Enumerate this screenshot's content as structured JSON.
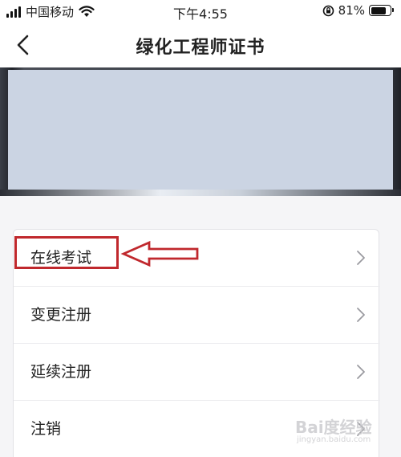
{
  "status_bar": {
    "carrier": "中国移动",
    "time": "下午4:55",
    "battery_percent": "81%",
    "battery_level": 0.81
  },
  "nav": {
    "title": "绿化工程师证书",
    "back_icon": "chevron-left-icon"
  },
  "menu": {
    "items": [
      {
        "label": "在线考试",
        "icon": "chevron-right-icon"
      },
      {
        "label": "变更注册",
        "icon": "chevron-right-icon"
      },
      {
        "label": "延续注册",
        "icon": "chevron-right-icon"
      },
      {
        "label": "注销",
        "icon": "chevron-right-icon"
      }
    ]
  },
  "annotation": {
    "color": "#c0282d",
    "target": "在线考试"
  },
  "watermark": {
    "brand": "Bai度经验",
    "site": "jingyan.baidu.com"
  }
}
